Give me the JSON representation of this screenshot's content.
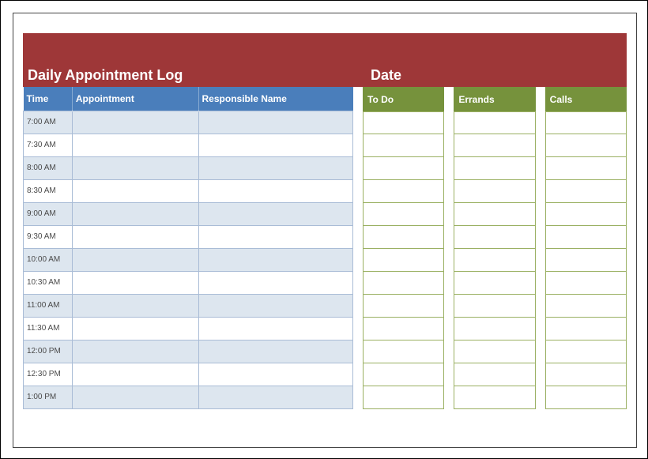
{
  "header": {
    "left_title": "Daily Appointment Log",
    "right_title": "Date"
  },
  "appointment_table": {
    "columns": [
      "Time",
      "Appointment",
      "Responsible Name"
    ],
    "rows": [
      {
        "time": "7:00 AM",
        "appointment": "",
        "responsible": ""
      },
      {
        "time": "7:30 AM",
        "appointment": "",
        "responsible": ""
      },
      {
        "time": "8:00 AM",
        "appointment": "",
        "responsible": ""
      },
      {
        "time": "8:30 AM",
        "appointment": "",
        "responsible": ""
      },
      {
        "time": "9:00 AM",
        "appointment": "",
        "responsible": ""
      },
      {
        "time": "9:30 AM",
        "appointment": "",
        "responsible": ""
      },
      {
        "time": "10:00 AM",
        "appointment": "",
        "responsible": ""
      },
      {
        "time": "10:30 AM",
        "appointment": "",
        "responsible": ""
      },
      {
        "time": "11:00 AM",
        "appointment": "",
        "responsible": ""
      },
      {
        "time": "11:30 AM",
        "appointment": "",
        "responsible": ""
      },
      {
        "time": "12:00 PM",
        "appointment": "",
        "responsible": ""
      },
      {
        "time": "12:30 PM",
        "appointment": "",
        "responsible": ""
      },
      {
        "time": "1:00 PM",
        "appointment": "",
        "responsible": ""
      }
    ]
  },
  "side_columns": [
    {
      "title": "To Do",
      "rows": [
        "",
        "",
        "",
        "",
        "",
        "",
        "",
        "",
        "",
        "",
        "",
        "",
        ""
      ]
    },
    {
      "title": "Errands",
      "rows": [
        "",
        "",
        "",
        "",
        "",
        "",
        "",
        "",
        "",
        "",
        "",
        "",
        ""
      ]
    },
    {
      "title": "Calls",
      "rows": [
        "",
        "",
        "",
        "",
        "",
        "",
        "",
        "",
        "",
        "",
        "",
        "",
        ""
      ]
    }
  ]
}
